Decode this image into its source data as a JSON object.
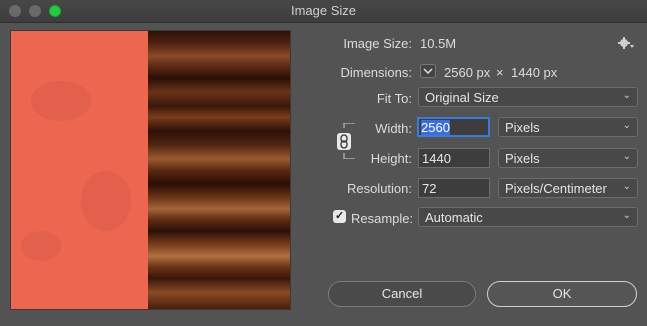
{
  "window": {
    "title": "Image Size"
  },
  "info": {
    "image_size_label": "Image Size:",
    "image_size_value": "10.5M",
    "dimensions_label": "Dimensions:",
    "dimensions_width": "2560 px",
    "dimensions_times": "×",
    "dimensions_height": "1440 px"
  },
  "fit_to": {
    "label": "Fit To:",
    "value": "Original Size"
  },
  "width": {
    "label": "Width:",
    "value": "2560",
    "unit": "Pixels"
  },
  "height": {
    "label": "Height:",
    "value": "1440",
    "unit": "Pixels"
  },
  "resolution": {
    "label": "Resolution:",
    "value": "72",
    "unit": "Pixels/Centimeter"
  },
  "resample": {
    "label": "Resample:",
    "checked": true,
    "value": "Automatic"
  },
  "buttons": {
    "cancel": "Cancel",
    "ok": "OK"
  },
  "icons": {
    "settings": "gear-icon",
    "dimensions_toggle": "chevron-down-icon",
    "constrain": "link-icon"
  },
  "colors": {
    "accent": "#3b7bd9",
    "window_bg": "#535353",
    "zoom_button": "#28c840"
  }
}
